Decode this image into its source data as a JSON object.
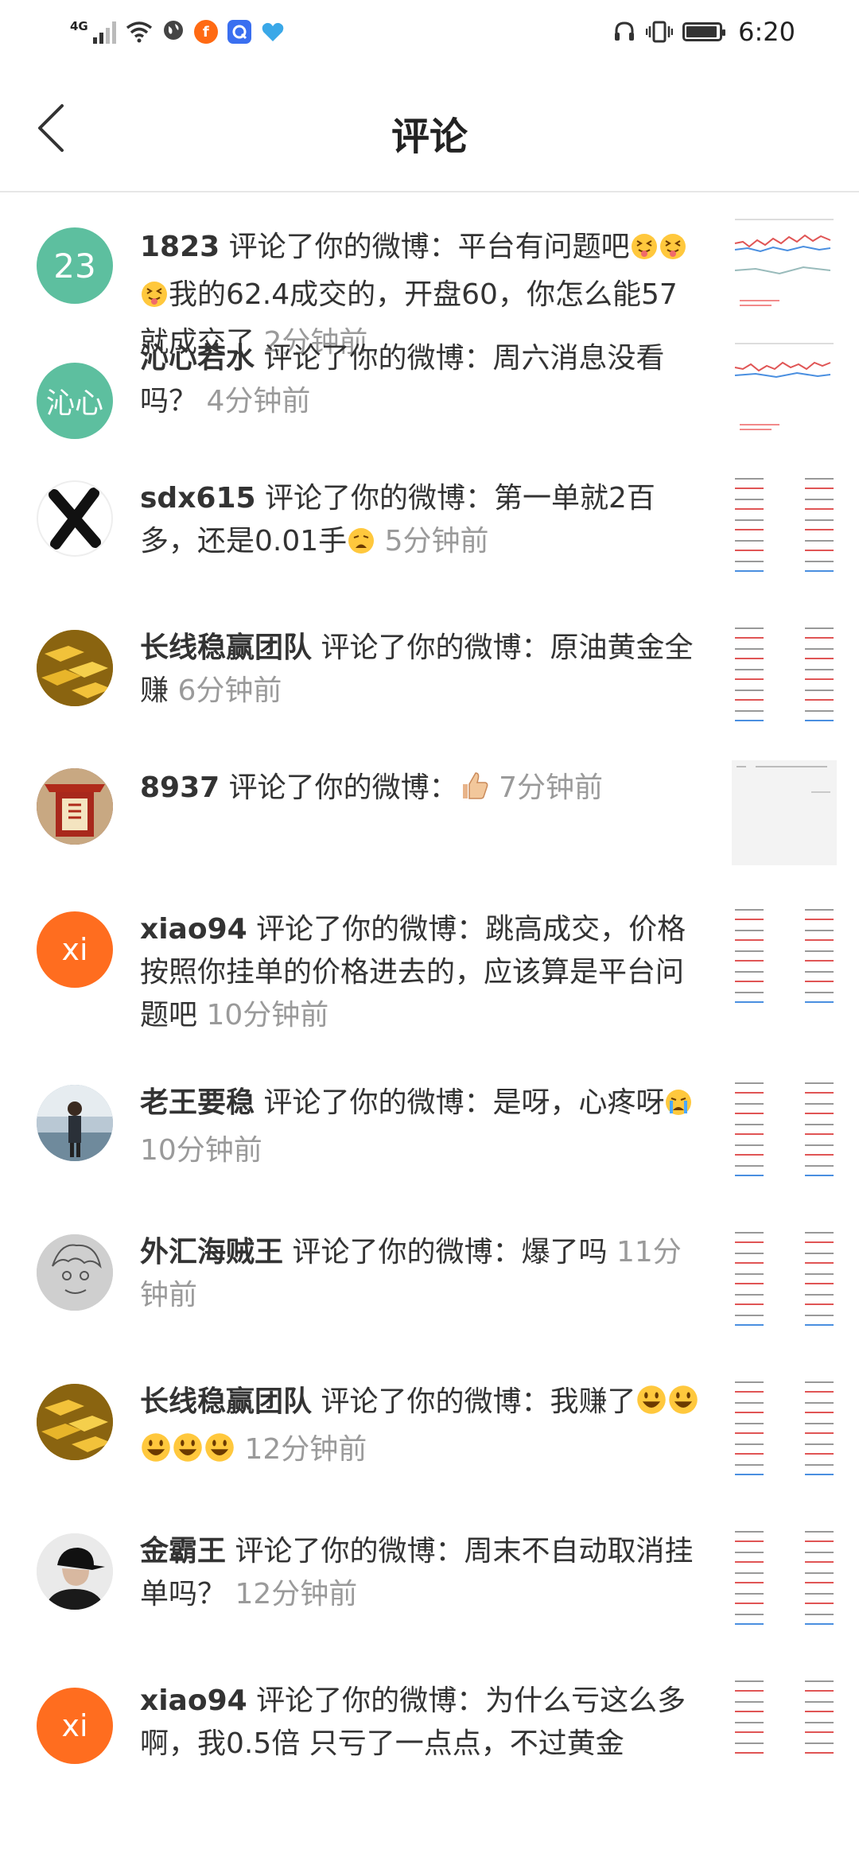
{
  "status_bar": {
    "network": "4G",
    "time": "6:20"
  },
  "header": {
    "title": "评论"
  },
  "colors": {
    "teal_avatar": "#5dbf9f",
    "orange_avatar": "#ff6d1f",
    "time_gray": "#9a9a9a"
  },
  "comments": [
    {
      "user": "1823",
      "avatar_text": "23",
      "text": "评论了你的微博：平台有问题吧",
      "emojis_mid": [
        "squint-tongue",
        "squint-tongue",
        "squint-tongue"
      ],
      "text2": "我的62.4成交的，开盘60，你怎么能57就成交了",
      "time": "2分钟前"
    },
    {
      "user": "沁心若水",
      "avatar_text": "沁心",
      "text": "评论了你的微博：周六消息没看吗？",
      "time": "4分钟前"
    },
    {
      "user": "sdx615",
      "text": "评论了你的微博：第一单就2百多，还是0.01手",
      "emoji_end": "weary",
      "time": "5分钟前"
    },
    {
      "user": "长线稳赢团队",
      "text": "评论了你的微博：原油黄金全赚",
      "time": "6分钟前"
    },
    {
      "user": "8937",
      "text": "评论了你的微博：",
      "emoji_end": "thumbs-up",
      "time": "7分钟前"
    },
    {
      "user": "xiao94",
      "avatar_text": "xi",
      "text": "评论了你的微博：跳高成交，价格按照你挂单的价格进去的，应该算是平台问题吧",
      "time": "10分钟前"
    },
    {
      "user": "老王要稳",
      "text": "评论了你的微博：是呀，心疼呀",
      "emoji_end": "crying",
      "time": "10分钟前"
    },
    {
      "user": "外汇海贼王",
      "text": "评论了你的微博：爆了吗",
      "time": "11分钟前"
    },
    {
      "user": "长线稳赢团队",
      "text": "评论了你的微博：我赚了",
      "emojis_end": [
        "grin",
        "grin",
        "grin",
        "grin",
        "grin"
      ],
      "time": "12分钟前"
    },
    {
      "user": "金霸王",
      "text": "评论了你的微博：周末不自动取消挂单吗？",
      "time": "12分钟前"
    },
    {
      "user": "xiao94",
      "avatar_text": "xi",
      "text": "评论了你的微博：为什么亏这么多啊，我0.5倍 只亏了一点点，不过黄金"
    }
  ]
}
